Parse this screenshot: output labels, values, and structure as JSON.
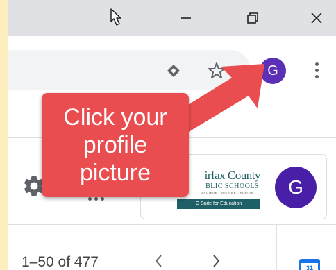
{
  "window": {
    "minimize_icon": "minimize-icon",
    "restore_icon": "restore-icon",
    "close_icon": "close-icon"
  },
  "toolbar": {
    "extension_icon": "extension-diamond-icon",
    "bookmark_icon": "star-icon",
    "profile_initial": "G",
    "menu_icon": "three-dot-menu-icon"
  },
  "header": {
    "settings_icon": "gear-icon",
    "apps_icon": "apps-grid-icon",
    "account": {
      "org_line1": "irfax County",
      "org_line2": "BLIC SCHOOLS",
      "org_tagline": "ACHIEVE · INSPIRE · THRIVE",
      "suite_label": "G Suite for Education",
      "avatar_initial": "G"
    }
  },
  "mail_list": {
    "pagination_text": "1–50 of 477",
    "prev_icon": "chevron-left-icon",
    "next_icon": "chevron-right-icon",
    "calendar_day": "31"
  },
  "annotation": {
    "lines": [
      "Click your",
      "profile",
      "picture"
    ],
    "color": "#ea4d50"
  },
  "colors": {
    "background": "#fdeebd",
    "titlebar": "#dfe1e5",
    "avatar": "#5b2fb6"
  }
}
